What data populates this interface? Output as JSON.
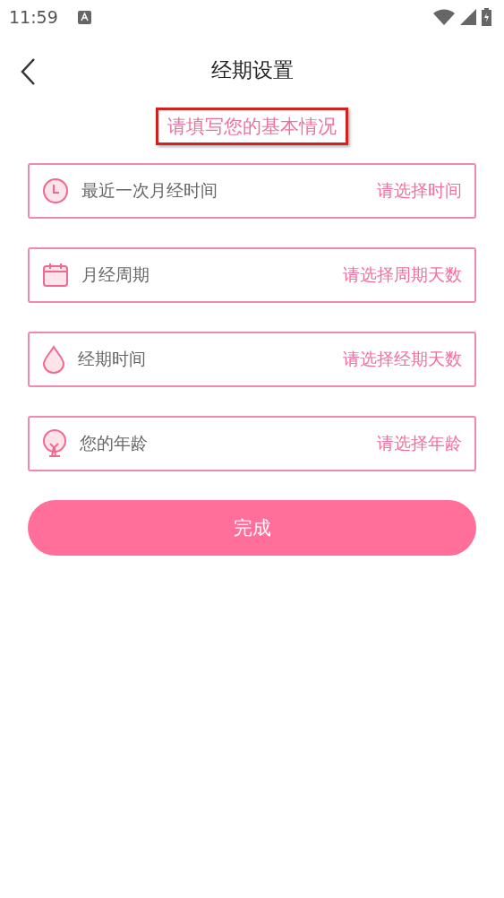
{
  "status_bar": {
    "time": "11:59"
  },
  "header": {
    "title": "经期设置"
  },
  "heading": "请填写您的基本情况",
  "fields": [
    {
      "kind": "clock",
      "label": "最近一次月经时间",
      "placeholder": "请选择时间"
    },
    {
      "kind": "calendar",
      "label": "月经周期",
      "placeholder": "请选择周期天数"
    },
    {
      "kind": "drop",
      "label": "经期时间",
      "placeholder": "请选择经期天数"
    },
    {
      "kind": "tree",
      "label": "您的年龄",
      "placeholder": "请选择年龄"
    }
  ],
  "submit": "完成"
}
